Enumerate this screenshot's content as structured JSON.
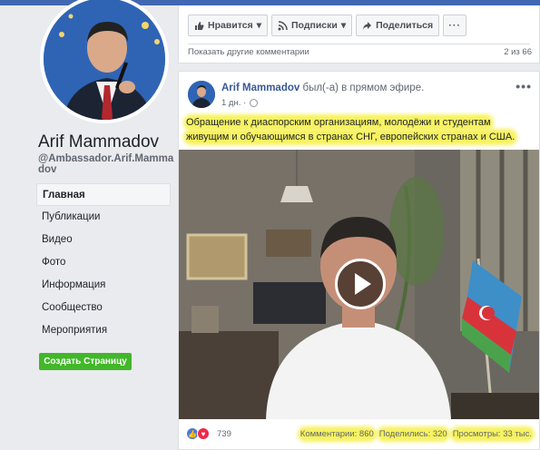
{
  "page": {
    "name": "Arif Mammadov",
    "handle": "@Ambassador.Arif.Mammadov"
  },
  "nav": {
    "items": [
      {
        "label": "Главная",
        "active": true
      },
      {
        "label": "Публикации"
      },
      {
        "label": "Видео"
      },
      {
        "label": "Фото"
      },
      {
        "label": "Информация"
      },
      {
        "label": "Сообщество"
      },
      {
        "label": "Мероприятия"
      }
    ],
    "create_button": "Создать Страницу"
  },
  "top_card": {
    "like_label": "Нравится",
    "follow_label": "Подписки",
    "share_label": "Поделиться",
    "more_label": "···",
    "more_comments": "Показать другие комментарии",
    "comments_counter": "2 из 66"
  },
  "post": {
    "author": "Arif Mammadov",
    "live_text": "был(-а) в прямом эфире.",
    "time": "1 дн. ·",
    "menu": "•••",
    "text_line1": "Обращение к диаспорским организациям, молодёжи и студентам",
    "text_line2": "живущим и обучающимся в странах СНГ, европейских странах и США.",
    "reaction_count": "739",
    "comments": "Комментарии: 860",
    "shares": "Поделились: 320",
    "views": "Просмотры: 33 тыс."
  },
  "colors": {
    "brand": "#4267b2",
    "link": "#385898",
    "highlight": "#f7f260",
    "create_button": "#42b72a"
  },
  "icons": [
    "like-icon",
    "rss-icon",
    "share-icon",
    "globe-icon",
    "play-icon",
    "love-icon"
  ]
}
